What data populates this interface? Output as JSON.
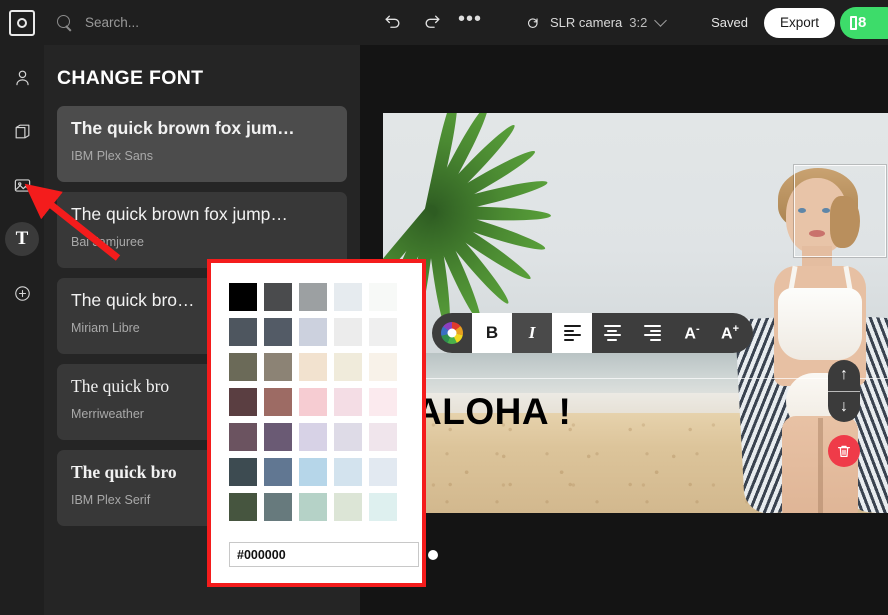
{
  "app": {
    "logo_icon": "camera-square-logo",
    "search_placeholder": "Search...",
    "search_value": ""
  },
  "toolbar": {
    "undo_label": "Undo",
    "redo_label": "Redo",
    "more_label": "•••",
    "rotate_icon": "rotate-icon",
    "document_name": "SLR camera",
    "aspect_ratio": "3:2",
    "save_status": "Saved",
    "export_label": "Export",
    "share_label": ""
  },
  "rail": {
    "items": [
      {
        "name": "person-icon",
        "label": "People"
      },
      {
        "name": "cube-icon",
        "label": "Objects"
      },
      {
        "name": "image-icon",
        "label": "Image"
      },
      {
        "name": "text-icon",
        "label": "T"
      },
      {
        "name": "plus-icon",
        "label": "Add"
      }
    ],
    "active_index": 3
  },
  "panel": {
    "title": "CHANGE FONT",
    "preview_full": "The quick brown fox jumps over the lazy dog",
    "fonts": [
      {
        "preview": "The quick brown fox jum…",
        "name": "IBM Plex Sans",
        "selected": true,
        "style": "fp-sans"
      },
      {
        "preview": "The quick brown fox jump…",
        "name": "Bai Jamjuree",
        "selected": false,
        "style": "fp-sans"
      },
      {
        "preview": "The quick bro…",
        "name": "Miriam Libre",
        "selected": false,
        "style": "fp-sans"
      },
      {
        "preview": "The quick bro",
        "name": "Merriweather",
        "selected": false,
        "style": "fp-serif"
      },
      {
        "preview": "The quick bro",
        "name": "IBM Plex Serif",
        "selected": false,
        "style": "fp-serif-bold"
      }
    ]
  },
  "canvas": {
    "text_layer": "ALOHA !",
    "text_color": "#000000",
    "selection_label": "face-selection-box"
  },
  "format_toolbar": {
    "color_label": "",
    "bold_label": "B",
    "italic_label": "I",
    "align_left_label": "",
    "align_center_label": "",
    "align_right_label": "",
    "font_smaller_label": "A",
    "font_smaller_sup": "-",
    "font_larger_label": "A",
    "font_larger_sup": "+",
    "active": [
      "bold",
      "align-left"
    ]
  },
  "layer_controls": {
    "move_up_label": "↑",
    "move_down_label": "↓",
    "delete_label": "Delete"
  },
  "color_picker": {
    "hex_value": "#000000",
    "hex_placeholder": "#000000",
    "wheel_label": "custom-color",
    "columns": 5,
    "rows": 7,
    "swatches": [
      [
        "#000000",
        "#4a4b4d",
        "#9ca0a2",
        "#e6ebef",
        "#f7f9f7"
      ],
      [
        "#4e565f",
        "#535b66",
        "#ccd1de",
        "#ececec",
        "#efefef"
      ],
      [
        "#6b6a58",
        "#8c8375",
        "#f2e2cf",
        "#f0ebdb",
        "#f8f2e9"
      ],
      [
        "#5a3e41",
        "#9d6b64",
        "#f6ccd2",
        "#f4dde5",
        "#fbeaee"
      ],
      [
        "#6b5360",
        "#6a5a74",
        "#d7d2e6",
        "#dedbe7",
        "#f0e5ec"
      ],
      [
        "#3d4b51",
        "#617792",
        "#b6d6e9",
        "#d3e3ee",
        "#e2e9f1"
      ],
      [
        "#46553f",
        "#677a7d",
        "#b5d2c7",
        "#dce5d6",
        "#def0ef"
      ]
    ]
  },
  "annotations": {
    "highlight_box": "color-picker-highlight",
    "arrow": "pointer-to-text-tool"
  }
}
